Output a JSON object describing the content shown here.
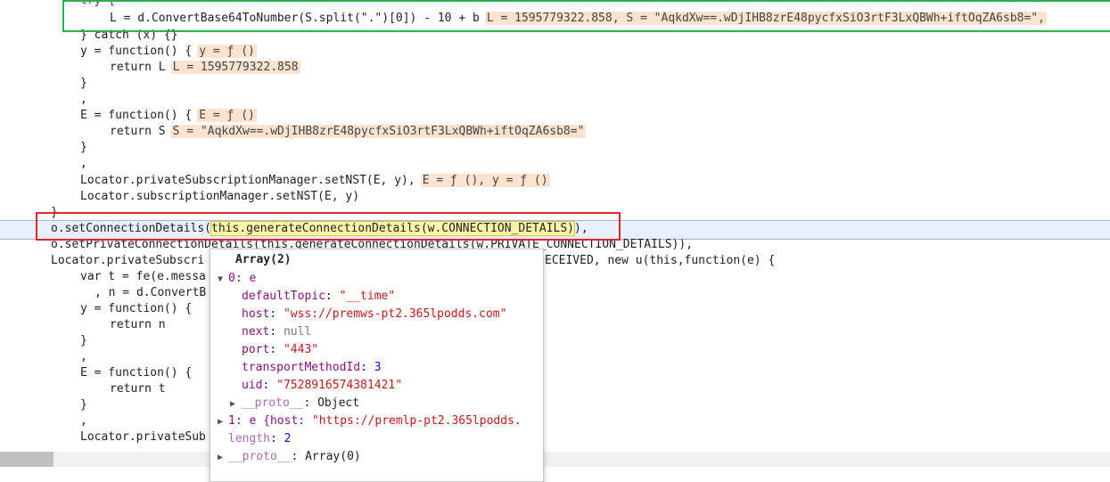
{
  "code": {
    "l0": {
      "a": "try {"
    },
    "l1": {
      "a": "L = d.ConvertBase64ToNumber(S.split(\".\")[0]) - 10 + b",
      "val": "L = 1595779322.858, S = \"AqkdXw==.wDjIHB8zrE48pycfxSiO3rtF3LxQBWh+iftOqZA6sb8=\","
    },
    "l2": {
      "a": "} catch (x) {}"
    },
    "l3": {
      "a": "y = function() {",
      "val": "y = ƒ ()"
    },
    "l4": {
      "a": "return L",
      "val": "L = 1595779322.858"
    },
    "l5": {
      "a": "}"
    },
    "l6": {
      "a": ","
    },
    "l7": {
      "a": "E = function() {",
      "val": "E = ƒ ()"
    },
    "l8": {
      "a": "return S",
      "val": "S = \"AqkdXw==.wDjIHB8zrE48pycfxSiO3rtF3LxQBWh+iftOqZA6sb8=\""
    },
    "l9": {
      "a": "}"
    },
    "l10": {
      "a": ","
    },
    "l11": {
      "a": "Locator.privateSubscriptionManager.setNST(E, y),",
      "val": "E = ƒ (), y = ƒ ()"
    },
    "l12": {
      "a": "Locator.subscriptionManager.setNST(E, y)"
    },
    "l13": {
      "a": "}"
    },
    "l14": {
      "a": "o.setConnectionDetails(",
      "sel": "this.generateConnectionDetails(w.CONNECTION_DETAILS)",
      "b": "),"
    },
    "l15": {
      "a": "o.setPrivateConnectionDetails(this.generateConnectionDetails(w.PRIVATE_CONNECTION_DETAILS)),"
    },
    "l16": {
      "a": "Locator.privateSubscri",
      "b": "ECEIVED, new u(this,function(e) {"
    },
    "l17": {
      "a": "var t = fe(e.messa"
    },
    "l18": {
      "a": ", n = d.ConvertB"
    },
    "l19": {
      "a": "y = function() {"
    },
    "l20": {
      "a": "return n"
    },
    "l21": {
      "a": "}"
    },
    "l22": {
      "a": ","
    },
    "l23": {
      "a": "E = function() {"
    },
    "l24": {
      "a": "return t"
    },
    "l25": {
      "a": "}"
    },
    "l26": {
      "a": ","
    },
    "l27": {
      "a": "Locator.privateSub"
    }
  },
  "popup": {
    "title": "Array(2)",
    "item0": {
      "label": "0: e"
    },
    "defaultTopic": {
      "k": "defaultTopic",
      "v": "\"__time\""
    },
    "host": {
      "k": "host",
      "v": "\"wss://premws-pt2.365lpodds.com\""
    },
    "next": {
      "k": "next",
      "v": "null"
    },
    "port": {
      "k": "port",
      "v": "\"443\""
    },
    "transportMethodId": {
      "k": "transportMethodId",
      "v": "3"
    },
    "uid": {
      "k": "uid",
      "v": "\"7528916574381421\""
    },
    "proto0": {
      "k": "__proto__",
      "v": "Object"
    },
    "item1": {
      "a": "1: e {host: ",
      "v": "\"https://premlp-pt2.365lpodds."
    },
    "length": {
      "k": "length",
      "v": "2"
    },
    "proto": {
      "k": "__proto__",
      "v": "Array(0)"
    }
  }
}
